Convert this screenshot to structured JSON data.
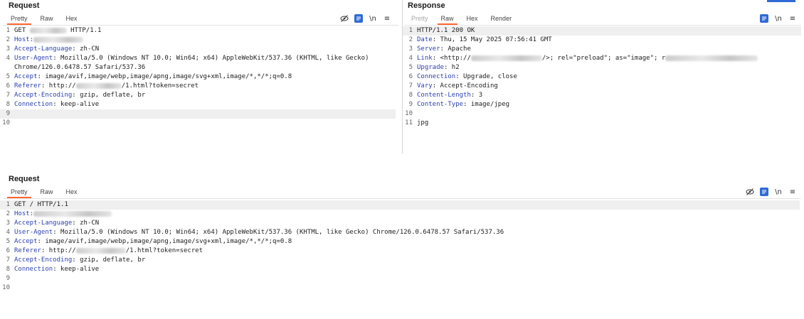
{
  "top_left": {
    "title": "Request",
    "tabs": [
      "Pretty",
      "Raw",
      "Hex"
    ],
    "active_tab": 0,
    "lines": [
      {
        "n": "1",
        "parts": [
          {
            "t": "GET ",
            "k": false
          },
          {
            "blur": 52
          },
          {
            "t": " HTTP/1.1",
            "k": false
          }
        ]
      },
      {
        "n": "2",
        "parts": [
          {
            "t": "Host:",
            "k": true
          },
          {
            "blur": 70
          }
        ]
      },
      {
        "n": "3",
        "parts": [
          {
            "t": "Accept-Language",
            "k": true
          },
          {
            "t": ": zh-CN",
            "k": false
          }
        ]
      },
      {
        "n": "4",
        "parts": [
          {
            "t": "User-Agent",
            "k": true
          },
          {
            "t": ": Mozilla/5.0 (Windows NT 10.0; Win64; x64) AppleWebKit/537.36 (KHTML, like Gecko)",
            "k": false
          }
        ]
      },
      {
        "n": "",
        "parts": [
          {
            "t": "Chrome/126.0.6478.57 Safari/537.36",
            "k": false
          }
        ]
      },
      {
        "n": "5",
        "parts": [
          {
            "t": "Accept",
            "k": true
          },
          {
            "t": ": image/avif,image/webp,image/apng,image/svg+xml,image/*,*/*;q=0.8",
            "k": false
          }
        ]
      },
      {
        "n": "6",
        "parts": [
          {
            "t": "Referer",
            "k": true
          },
          {
            "t": ": http://",
            "k": false
          },
          {
            "blur": 64
          },
          {
            "t": "/1.html?token=secret",
            "k": false
          }
        ]
      },
      {
        "n": "7",
        "parts": [
          {
            "t": "Accept-Encoding",
            "k": true
          },
          {
            "t": ": gzip, deflate, br",
            "k": false
          }
        ]
      },
      {
        "n": "8",
        "parts": [
          {
            "t": "Connection",
            "k": true
          },
          {
            "t": ": keep-alive",
            "k": false
          }
        ]
      },
      {
        "n": "9",
        "parts": [],
        "hl": true
      },
      {
        "n": "10",
        "parts": []
      }
    ]
  },
  "top_right": {
    "title": "Response",
    "tabs": [
      "Pretty",
      "Raw",
      "Hex",
      "Render"
    ],
    "active_tab": 1,
    "lines": [
      {
        "n": "1",
        "parts": [
          {
            "t": "HTTP/1.1 200 OK",
            "k": false
          }
        ],
        "hl": true
      },
      {
        "n": "2",
        "parts": [
          {
            "t": "Date",
            "k": true
          },
          {
            "t": ": Thu, 15 May 2025 07:56:41 GMT",
            "k": false
          }
        ]
      },
      {
        "n": "3",
        "parts": [
          {
            "t": "Server",
            "k": true
          },
          {
            "t": ": Apache",
            "k": false
          }
        ]
      },
      {
        "n": "4",
        "parts": [
          {
            "t": "Link",
            "k": true
          },
          {
            "t": ": <http://",
            "k": false
          },
          {
            "blur": 100
          },
          {
            "t": "/>; rel=\"preload\"; as=\"image\"; r",
            "k": false
          },
          {
            "blur": 130
          }
        ]
      },
      {
        "n": "5",
        "parts": [
          {
            "t": "Upgrade",
            "k": true
          },
          {
            "t": ": h2",
            "k": false
          }
        ]
      },
      {
        "n": "6",
        "parts": [
          {
            "t": "Connection",
            "k": true
          },
          {
            "t": ": Upgrade, close",
            "k": false
          }
        ]
      },
      {
        "n": "7",
        "parts": [
          {
            "t": "Vary",
            "k": true
          },
          {
            "t": ": Accept-Encoding",
            "k": false
          }
        ]
      },
      {
        "n": "8",
        "parts": [
          {
            "t": "Content-Length",
            "k": true
          },
          {
            "t": ": 3",
            "k": false
          }
        ]
      },
      {
        "n": "9",
        "parts": [
          {
            "t": "Content-Type",
            "k": true
          },
          {
            "t": ": image/jpeg",
            "k": false
          }
        ]
      },
      {
        "n": "10",
        "parts": []
      },
      {
        "n": "11",
        "parts": [
          {
            "t": "jpg",
            "k": false
          }
        ]
      }
    ]
  },
  "bottom": {
    "title": "Request",
    "tabs": [
      "Pretty",
      "Raw",
      "Hex"
    ],
    "active_tab": 0,
    "lines": [
      {
        "n": "1",
        "parts": [
          {
            "t": "GET / HTTP/1.1",
            "k": false
          }
        ],
        "hl": true
      },
      {
        "n": "2",
        "parts": [
          {
            "t": "Host:",
            "k": true
          },
          {
            "blur": 110
          }
        ]
      },
      {
        "n": "3",
        "parts": [
          {
            "t": "Accept-Language",
            "k": true
          },
          {
            "t": ": zh-CN",
            "k": false
          }
        ]
      },
      {
        "n": "4",
        "parts": [
          {
            "t": "User-Agent",
            "k": true
          },
          {
            "t": ": Mozilla/5.0 (Windows NT 10.0; Win64; x64) AppleWebKit/537.36 (KHTML, like Gecko) Chrome/126.0.6478.57 Safari/537.36",
            "k": false
          }
        ]
      },
      {
        "n": "5",
        "parts": [
          {
            "t": "Accept",
            "k": true
          },
          {
            "t": ": image/avif,image/webp,image/apng,image/svg+xml,image/*,*/*;q=0.8",
            "k": false
          }
        ]
      },
      {
        "n": "6",
        "parts": [
          {
            "t": "Referer",
            "k": true
          },
          {
            "t": ": http://",
            "k": false
          },
          {
            "blur": 70
          },
          {
            "t": "/1.html?token=secret",
            "k": false
          }
        ]
      },
      {
        "n": "7",
        "parts": [
          {
            "t": "Accept-Encoding",
            "k": true
          },
          {
            "t": ": gzip, deflate, br",
            "k": false
          }
        ]
      },
      {
        "n": "8",
        "parts": [
          {
            "t": "Connection",
            "k": true
          },
          {
            "t": ": keep-alive",
            "k": false
          }
        ]
      },
      {
        "n": "9",
        "parts": []
      },
      {
        "n": "10",
        "parts": []
      }
    ]
  },
  "icons": {
    "hide": "eye-slash-icon",
    "wrap": "wrap-lines-icon",
    "newline": "\\n",
    "menu": "≡"
  },
  "colors": {
    "accent": "#ff6633",
    "header_key": "#2a3fb0",
    "button_blue": "#2f6ad6"
  }
}
